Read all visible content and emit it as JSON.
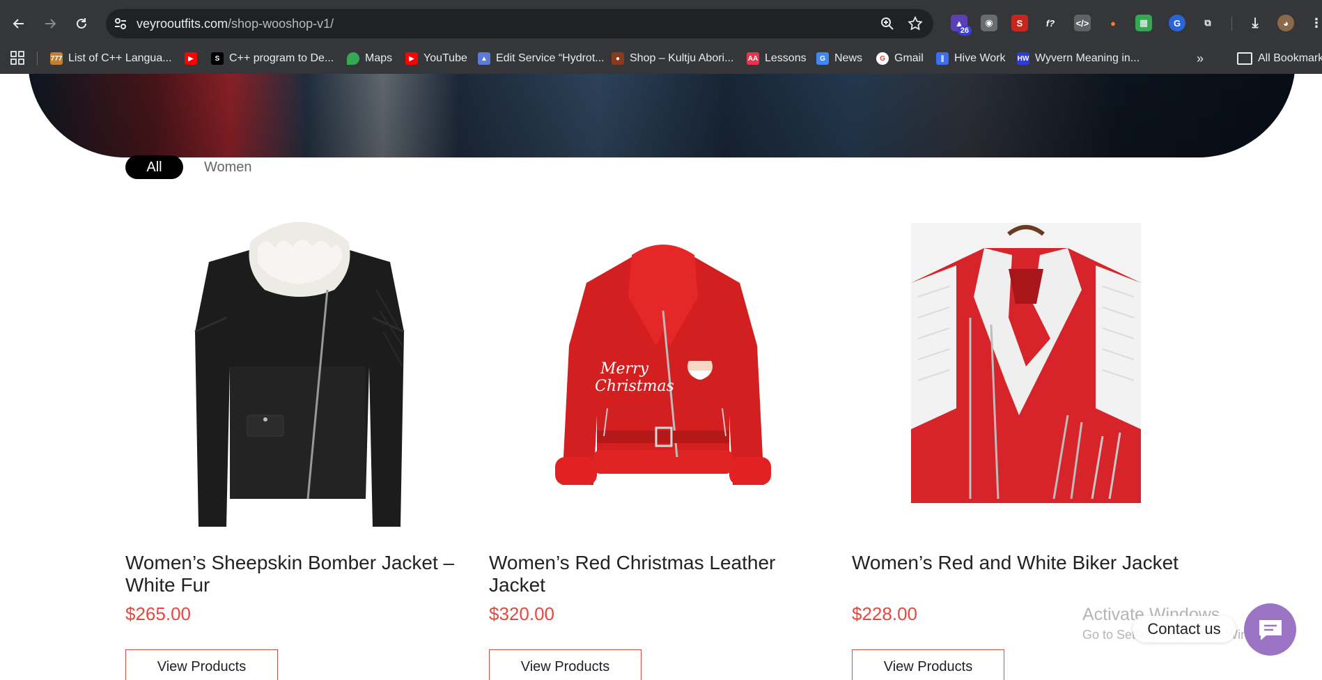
{
  "browser": {
    "url_main": "veyrooutfits.com",
    "url_path": "/shop-wooshop-v1/",
    "extension_badge": "26",
    "bookmarks": [
      {
        "label": "List of C++ Langua...",
        "icon": "bookmark-favicon-cpp-list",
        "color": "#c77d2a"
      },
      {
        "label": "",
        "icon": "youtube-icon",
        "color": "#ff0000"
      },
      {
        "label": "C++ program to De...",
        "icon": "bookmark-favicon-s",
        "color": "#000000"
      },
      {
        "label": "Maps",
        "icon": "maps-icon",
        "color": "#34a853"
      },
      {
        "label": "YouTube",
        "icon": "youtube-icon",
        "color": "#ff0000"
      },
      {
        "label": "Edit Service “Hydrot...",
        "icon": "bookmark-favicon-edit",
        "color": "#5b7bd6"
      },
      {
        "label": "Shop – Kultju Abori...",
        "icon": "bookmark-favicon-shop",
        "color": "#8a3b1c"
      },
      {
        "label": "Lessons",
        "icon": "bookmark-favicon-lessons",
        "color": "#e8344d"
      },
      {
        "label": "News",
        "icon": "google-news-icon",
        "color": "#4285f4"
      },
      {
        "label": "Gmail",
        "icon": "google-icon",
        "color": "#ea4335"
      },
      {
        "label": "Hive Work",
        "icon": "hive-icon",
        "color": "#3b6ef5"
      },
      {
        "label": "Wyvern Meaning in...",
        "icon": "bookmark-favicon-hw",
        "color": "#2f3bd8"
      }
    ],
    "all_bookmarks": "All Bookmarks"
  },
  "shop": {
    "filters": {
      "all": "All",
      "women": "Women"
    },
    "products": [
      {
        "title": "Women’s Sheepskin Bomber Jacket – White Fur",
        "price": "$265.00",
        "button": "View Products"
      },
      {
        "title": "Women’s Red Christmas Leather Jacket",
        "price": "$320.00",
        "button": "View Products"
      },
      {
        "title": "Women’s Red and White Biker Jacket",
        "price": "$228.00",
        "button": "View Products"
      }
    ]
  },
  "overlay": {
    "activate_title": "Activate Windows",
    "activate_sub": "Go to Settings to activate Windows.",
    "contact": "Contact us"
  },
  "colors": {
    "price": "#e8473c",
    "chat_button": "#9b74c6",
    "filter_active_bg": "#000000"
  }
}
